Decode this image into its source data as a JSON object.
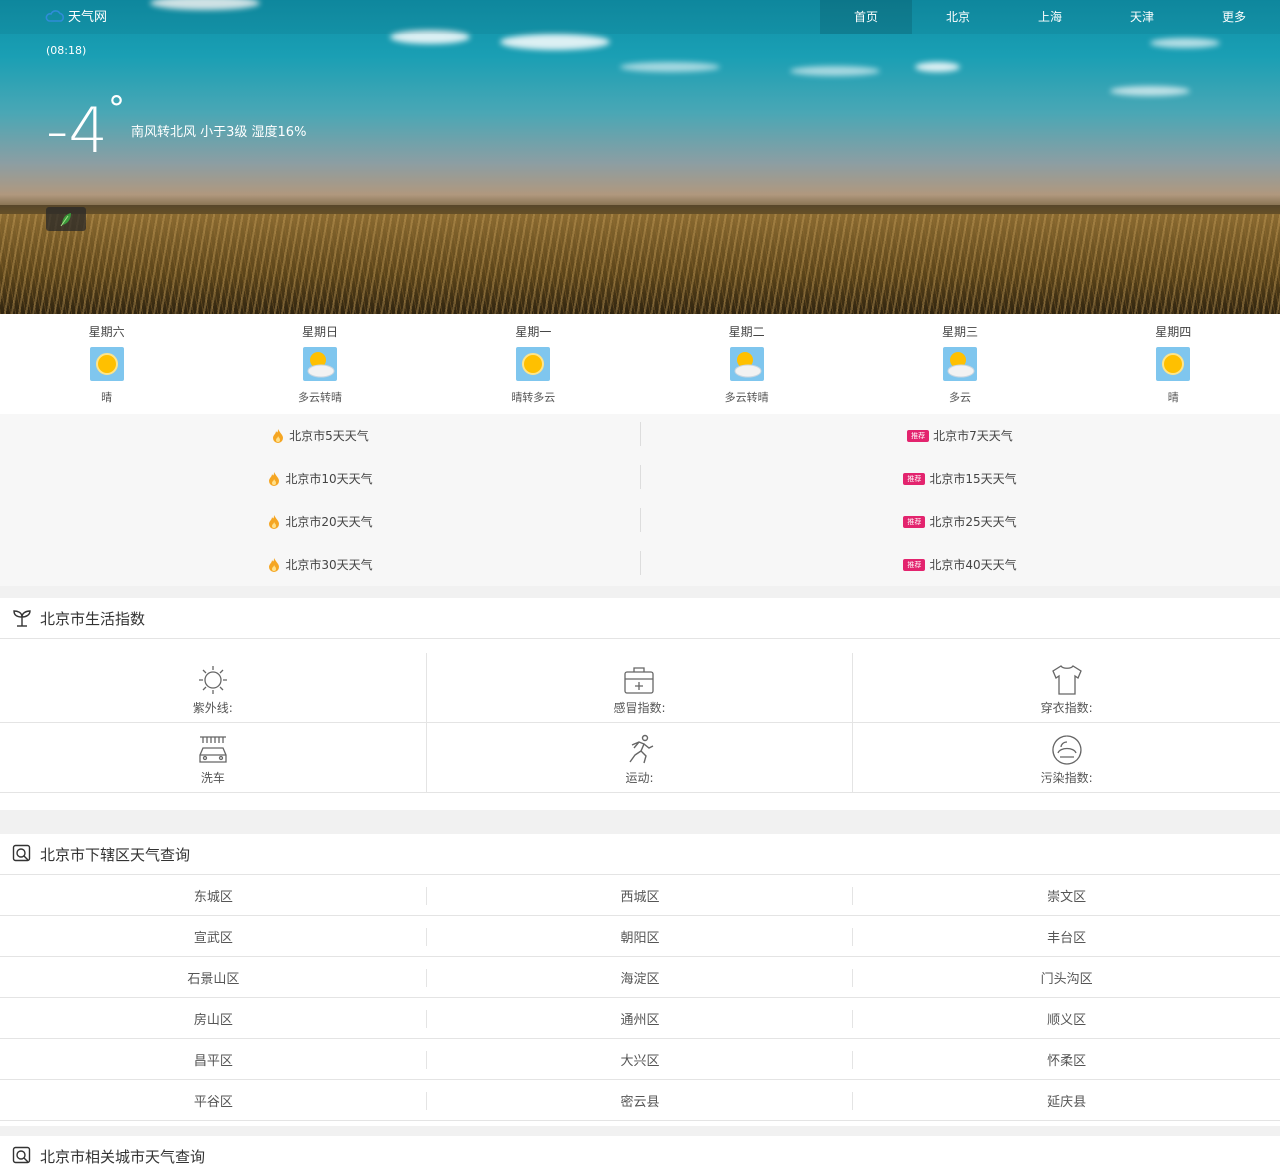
{
  "header": {
    "logo_text": "天气网",
    "nav": [
      "首页",
      "北京",
      "上海",
      "天津",
      "更多"
    ]
  },
  "current": {
    "time": "(08:18)",
    "temperature": "-4",
    "degree": "°",
    "condition": "南风转北风 小于3级 湿度16%"
  },
  "forecast": [
    {
      "day": "星期六",
      "icon": "sun-icon",
      "desc": "晴"
    },
    {
      "day": "星期日",
      "icon": "partly-cloudy-icon",
      "desc": "多云转晴"
    },
    {
      "day": "星期一",
      "icon": "sun-icon",
      "desc": "晴转多云"
    },
    {
      "day": "星期二",
      "icon": "partly-cloudy-icon",
      "desc": "多云转晴"
    },
    {
      "day": "星期三",
      "icon": "partly-cloudy-icon",
      "desc": "多云"
    },
    {
      "day": "星期四",
      "icon": "sun-icon",
      "desc": "晴"
    }
  ],
  "links": {
    "tag": "推荐",
    "left": [
      "北京市5天天气",
      "北京市10天天气",
      "北京市20天天气",
      "北京市30天天气"
    ],
    "right": [
      "北京市7天天气",
      "北京市15天天气",
      "北京市25天天气",
      "北京市40天天气"
    ]
  },
  "life_index": {
    "title": "北京市生活指数",
    "items": [
      {
        "label": "紫外线:",
        "icon": "sun-outline-icon"
      },
      {
        "label": "感冒指数:",
        "icon": "medical-kit-icon"
      },
      {
        "label": "穿衣指数:",
        "icon": "shirt-icon"
      },
      {
        "label": "洗车",
        "icon": "car-wash-icon"
      },
      {
        "label": "运动:",
        "icon": "runner-icon"
      },
      {
        "label": "污染指数:",
        "icon": "pollution-icon"
      }
    ]
  },
  "districts": {
    "title": "北京市下辖区天气查询",
    "items": [
      "东城区",
      "西城区",
      "崇文区",
      "宣武区",
      "朝阳区",
      "丰台区",
      "石景山区",
      "海淀区",
      "门头沟区",
      "房山区",
      "通州区",
      "顺义区",
      "昌平区",
      "大兴区",
      "怀柔区",
      "平谷区",
      "密云县",
      "延庆县"
    ]
  },
  "related": {
    "title": "北京市相关城市天气查询"
  },
  "colors": {
    "tag": "#e3246e",
    "flame": "#f5a623",
    "sun": "#ffc000"
  }
}
